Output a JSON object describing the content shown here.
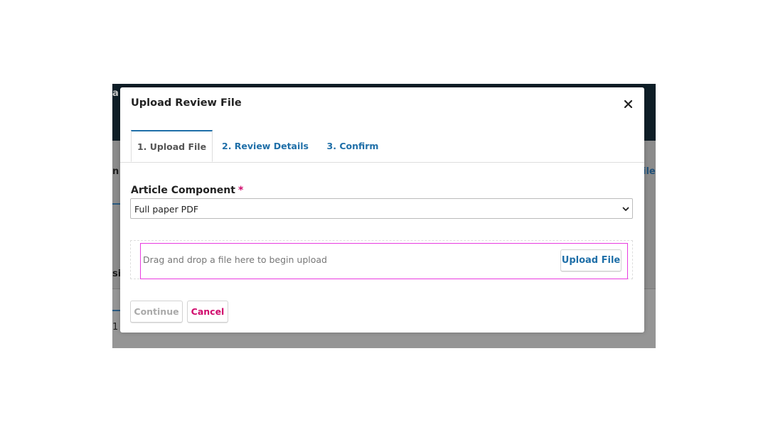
{
  "background": {
    "fragments": [
      "a",
      "n",
      "ile",
      "si",
      "1"
    ]
  },
  "modal": {
    "title": "Upload Review File",
    "close_icon": "close-icon",
    "tabs": [
      {
        "label": "1. Upload File",
        "active": true
      },
      {
        "label": "2. Review Details",
        "active": false
      },
      {
        "label": "3. Confirm",
        "active": false
      }
    ],
    "field": {
      "label": "Article Component",
      "required_marker": "*",
      "selected_value": "Full paper PDF",
      "dropdown_icon": "chevron-down-icon"
    },
    "dropzone": {
      "text": "Drag and drop a file here to begin upload",
      "button_label": "Upload File"
    },
    "actions": {
      "continue_label": "Continue",
      "cancel_label": "Cancel"
    }
  },
  "colors": {
    "link_blue": "#1f6fa8",
    "required_pink": "#d00a6c",
    "highlight_magenta": "#e83be0",
    "header_dark": "#0f1e27"
  }
}
